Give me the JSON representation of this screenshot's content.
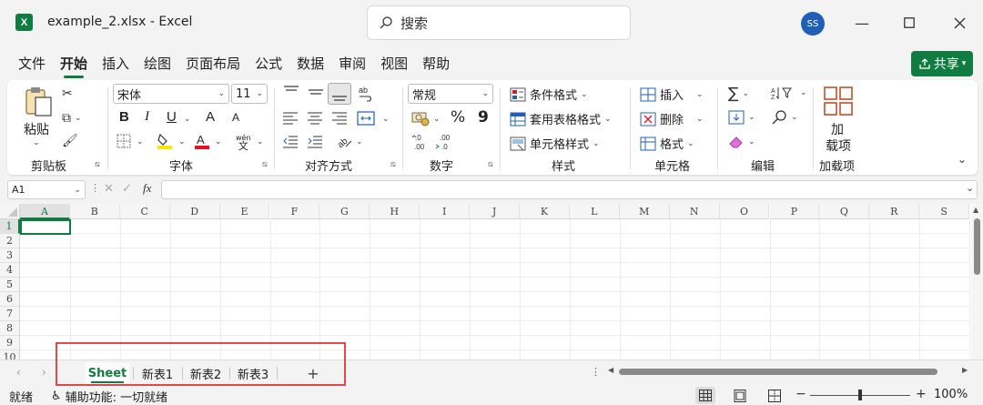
{
  "window": {
    "app_icon": "X",
    "title": "example_2.xlsx  -  Excel",
    "search_placeholder": "搜索",
    "avatar": "SS"
  },
  "menu": {
    "items": [
      "文件",
      "开始",
      "插入",
      "绘图",
      "页面布局",
      "公式",
      "数据",
      "审阅",
      "视图",
      "帮助"
    ],
    "active": "开始",
    "share_label": "共享"
  },
  "ribbon": {
    "clipboard": {
      "paste_label": "粘贴",
      "group_label": "剪贴板"
    },
    "font": {
      "font_name": "宋体",
      "font_size": "11",
      "bold": "B",
      "italic": "I",
      "underline": "U",
      "grow": "A",
      "shrink": "A",
      "phonetic": "wén",
      "group_label": "字体"
    },
    "alignment": {
      "group_label": "对齐方式"
    },
    "number": {
      "format": "常规",
      "percent": "%",
      "comma": "9",
      "inc_decimal": ".0\n.00",
      "group_label": "数字"
    },
    "styles": {
      "conditional": "条件格式",
      "table": "套用表格格式",
      "cell_styles": "单元格样式",
      "group_label": "样式"
    },
    "cells": {
      "insert": "插入",
      "delete": "删除",
      "format": "格式",
      "group_label": "单元格"
    },
    "editing": {
      "group_label": "编辑"
    },
    "addins": {
      "button_line1": "加",
      "button_line2": "载项",
      "group_label": "加载项"
    }
  },
  "formula_bar": {
    "name_box": "A1",
    "fx": "fx",
    "value": ""
  },
  "grid": {
    "columns": [
      "A",
      "B",
      "C",
      "D",
      "E",
      "F",
      "G",
      "H",
      "I",
      "J",
      "K",
      "L",
      "M",
      "N",
      "O",
      "P",
      "Q",
      "R",
      "S"
    ],
    "rows": [
      "1",
      "2",
      "3",
      "4",
      "5",
      "6",
      "7",
      "8",
      "9",
      "10"
    ]
  },
  "sheets": {
    "tabs": [
      "Sheet",
      "新表1",
      "新表2",
      "新表3"
    ],
    "active": "Sheet",
    "add_label": "+"
  },
  "status": {
    "ready": "就绪",
    "accessibility": "辅助功能: 一切就绪",
    "zoom_minus": "−",
    "zoom_plus": "+",
    "zoom": "100%"
  },
  "colors": {
    "accent": "#107c41",
    "highlight": "#e04a4a"
  }
}
